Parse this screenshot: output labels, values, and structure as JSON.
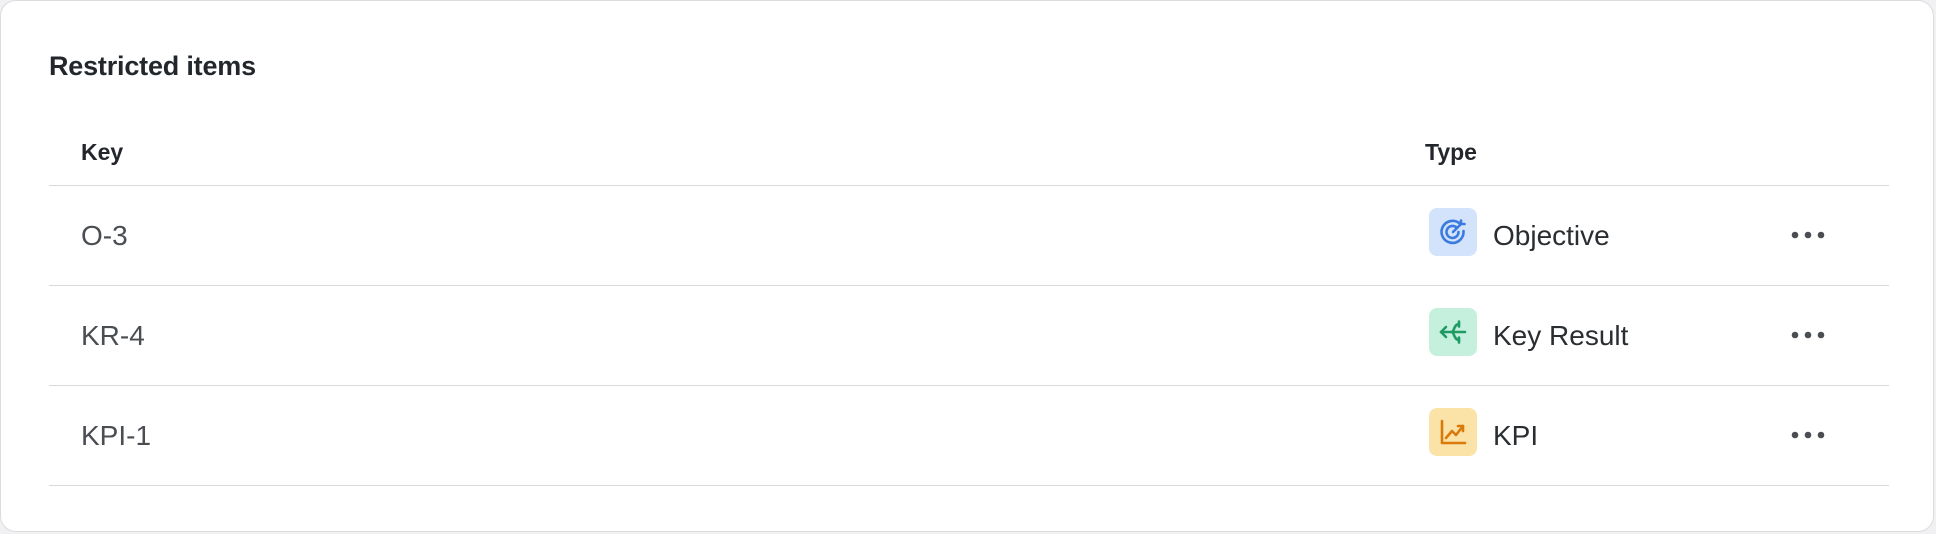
{
  "panel": {
    "title": "Restricted items"
  },
  "table": {
    "columns": {
      "key": "Key",
      "type": "Type"
    },
    "rows": [
      {
        "key": "O-3",
        "type": "Objective",
        "icon": "objective-target-icon",
        "icon_bg": "#d3e3fb",
        "icon_color": "#3b7be0"
      },
      {
        "key": "KR-4",
        "type": "Key Result",
        "icon": "key-result-branch-icon",
        "icon_bg": "#c5f0de",
        "icon_color": "#1f9b63"
      },
      {
        "key": "KPI-1",
        "type": "KPI",
        "icon": "kpi-trend-icon",
        "icon_bg": "#fbe3a8",
        "icon_color": "#d97a0b"
      }
    ],
    "row_action_icon": "more-horizontal-icon"
  }
}
